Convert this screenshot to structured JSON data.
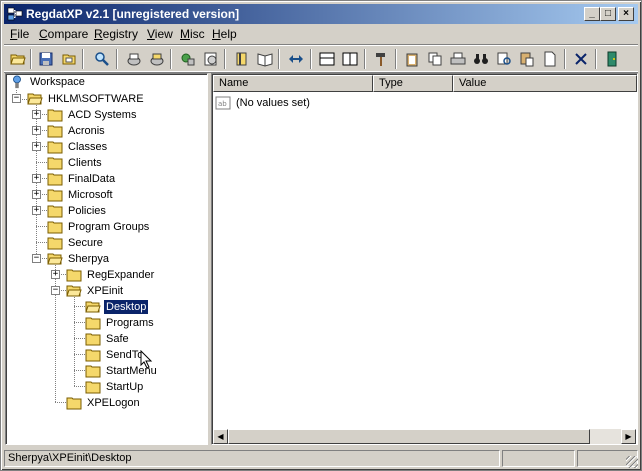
{
  "title": "RegdatXP v2.1  [unregistered version]",
  "window_buttons": {
    "minimize": "_",
    "maximize": "□",
    "close": "×"
  },
  "menu": [
    {
      "label": "File",
      "u": "F",
      "rest": "ile"
    },
    {
      "label": "Compare",
      "u": "C",
      "rest": "ompare"
    },
    {
      "label": "Registry",
      "u": "R",
      "rest": "egistry"
    },
    {
      "label": "View",
      "u": "V",
      "rest": "iew"
    },
    {
      "label": "Misc",
      "u": "M",
      "rest": "isc"
    },
    {
      "label": "Help",
      "u": "H",
      "rest": "elp"
    }
  ],
  "toolbar_icons": [
    "open-folder-icon",
    "save-disk-icon",
    "open-file-icon",
    "search-icon",
    "reg-scan-icon",
    "reg-compare-icon",
    "export-icon",
    "import-icon",
    "book-icon",
    "book-open-icon",
    "swap-arrows-icon",
    "split-horizontal-icon",
    "split-vertical-icon",
    "hammer-icon",
    "clipboard-icon",
    "copy-icon",
    "print-icon",
    "binoculars-icon",
    "find-next-icon",
    "paste-icon",
    "new-page-icon",
    "delete-icon",
    "exit-door-icon"
  ],
  "tree": {
    "root": "Workspace",
    "hive": "HKLM\\SOFTWARE",
    "keys": [
      {
        "label": "ACD Systems",
        "expandable": true
      },
      {
        "label": "Acronis",
        "expandable": true
      },
      {
        "label": "Classes",
        "expandable": true
      },
      {
        "label": "Clients",
        "expandable": false
      },
      {
        "label": "FinalData",
        "expandable": true
      },
      {
        "label": "Microsoft",
        "expandable": true
      },
      {
        "label": "Policies",
        "expandable": true
      },
      {
        "label": "Program Groups",
        "expandable": false
      },
      {
        "label": "Secure",
        "expandable": false
      },
      {
        "label": "Sherpya",
        "expandable": true,
        "expanded": true
      }
    ],
    "sherpya_children": [
      {
        "label": "RegExpander",
        "expandable": true
      },
      {
        "label": "XPEinit",
        "expandable": true,
        "expanded": true
      }
    ],
    "xpeinit_children": [
      "Desktop",
      "Programs",
      "Safe",
      "SendTo",
      "StartMenu",
      "StartUp"
    ],
    "selected": "Desktop",
    "after": "XPELogon"
  },
  "list": {
    "columns": [
      "Name",
      "Type",
      "Value"
    ],
    "empty_text": "(No values set)"
  },
  "status": {
    "path": "Sherpya\\XPEinit\\Desktop"
  },
  "colors": {
    "title_start": "#0a246a",
    "title_end": "#a6caf0",
    "folder": "#f5d86b",
    "selection": "#0a246a"
  }
}
